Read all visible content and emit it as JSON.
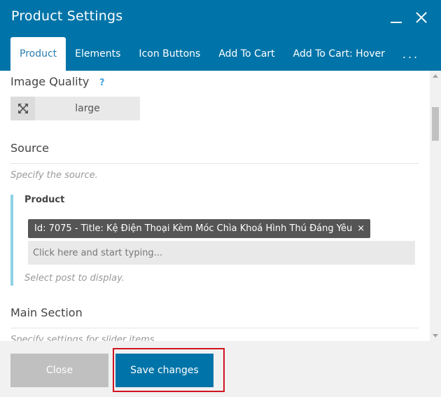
{
  "window": {
    "title": "Product Settings"
  },
  "tabs": [
    {
      "label": "Product",
      "active": true
    },
    {
      "label": "Elements",
      "active": false
    },
    {
      "label": "Icon Buttons",
      "active": false
    },
    {
      "label": "Add To Cart",
      "active": false
    },
    {
      "label": "Add To Cart: Hover",
      "active": false
    }
  ],
  "tabs_more_label": "...",
  "image_quality": {
    "label": "Image Quality",
    "help": "?",
    "value": "large"
  },
  "source": {
    "title": "Source",
    "description": "Specify the source.",
    "product": {
      "label": "Product",
      "selected_tag": "Id: 7075 - Title: Kệ Điện Thoại Kèm Móc Chìa Khoá Hình Thú Đáng Yêu",
      "tag_remove": "×",
      "placeholder": "Click here and start typing...",
      "hint": "Select post to display."
    }
  },
  "main_section": {
    "title": "Main Section",
    "description": "Specify settings for slider items."
  },
  "footer": {
    "close_label": "Close",
    "save_label": "Save changes"
  },
  "colors": {
    "header": "#0074a8",
    "active_tab_text": "#2d7fb0",
    "accent_bar": "#8fd2e6",
    "save_button": "#0074a8",
    "close_button": "#c0c0c0",
    "highlight": "#d0141f"
  }
}
